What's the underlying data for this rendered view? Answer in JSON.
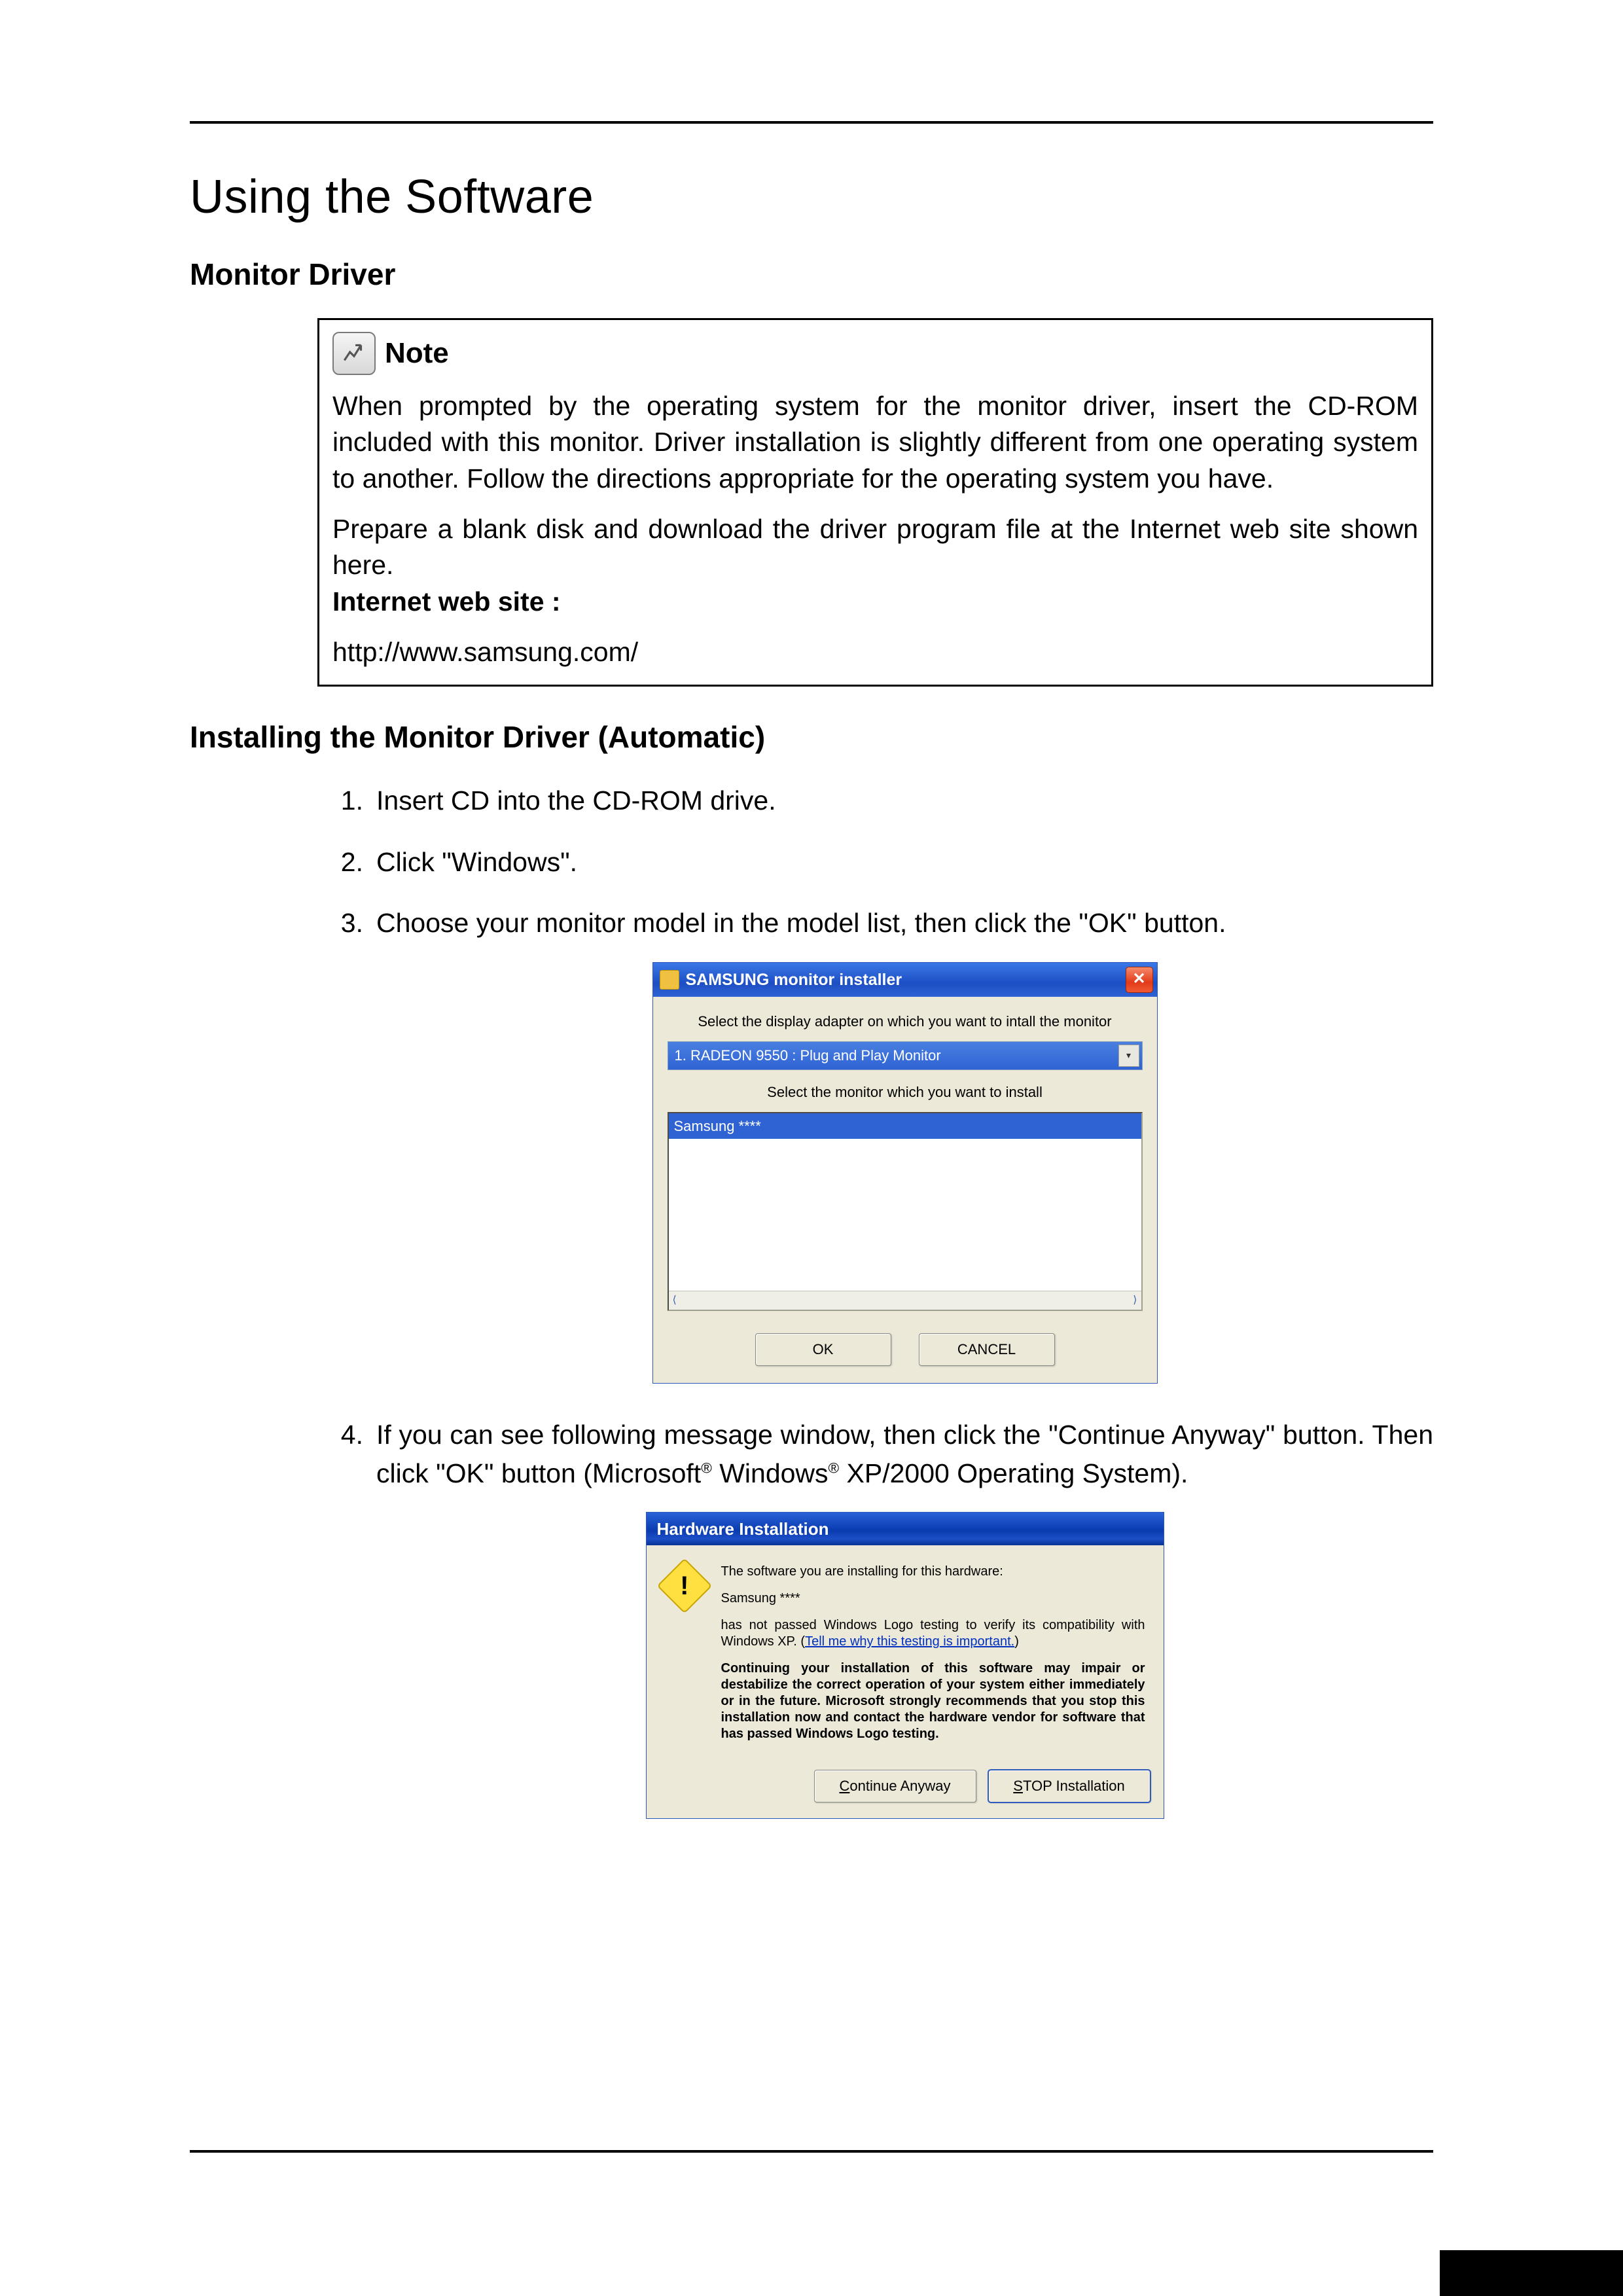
{
  "headings": {
    "h1": "Using the Software",
    "h2a": "Monitor Driver",
    "h2b": "Installing the Monitor Driver (Automatic)"
  },
  "note": {
    "label": "Note",
    "p1": "When prompted by the operating system for the monitor driver, insert the CD-ROM included with this monitor. Driver installation is slightly different from one operating system to another. Follow the directions appropriate for the operating system you have.",
    "p2": "Prepare a blank disk and download the driver program file at the Internet web site shown here.",
    "websiteLabel": "Internet web site :",
    "url": "http://www.samsung.com/"
  },
  "steps": {
    "s1": "Insert CD into the CD-ROM drive.",
    "s2": "Click \"Windows\".",
    "s3": "Choose your monitor model in the model list, then click the \"OK\" button.",
    "s4a": "If you can see following message window, then click the \"Continue Anyway\" button. Then click \"OK\" button (Microsoft",
    "s4b": " Windows",
    "s4c": " XP/2000 Operating System).",
    "reg": "®"
  },
  "dlg1": {
    "title": "SAMSUNG monitor installer",
    "close": "✕",
    "label1": "Select the display adapter on which you want to intall the monitor",
    "combo": "1. RADEON 9550 : Plug and Play Monitor",
    "dd": "▾",
    "label2": "Select the monitor which you want to install",
    "listSel": "Samsung ****",
    "scrollL": "⟨",
    "scrollR": "⟩",
    "ok": "OK",
    "cancel": "CANCEL"
  },
  "dlg2": {
    "title": "Hardware Installation",
    "bang": "!",
    "l1": "The software you are installing for this hardware:",
    "l2": "Samsung ****",
    "l3a": "has not passed Windows Logo testing to verify its compatibility with Windows XP. (",
    "l3link": "Tell me why this testing is important.",
    "l3b": ")",
    "l4": "Continuing your installation of this software may impair or destabilize the correct operation of your system either immediately or in the future. Microsoft strongly recommends that you stop this installation now and contact the hardware vendor for software that has passed Windows Logo testing.",
    "btnContC": "C",
    "btnContRest": "ontinue Anyway",
    "btnStopS": "S",
    "btnStopRest": "TOP Installation"
  }
}
